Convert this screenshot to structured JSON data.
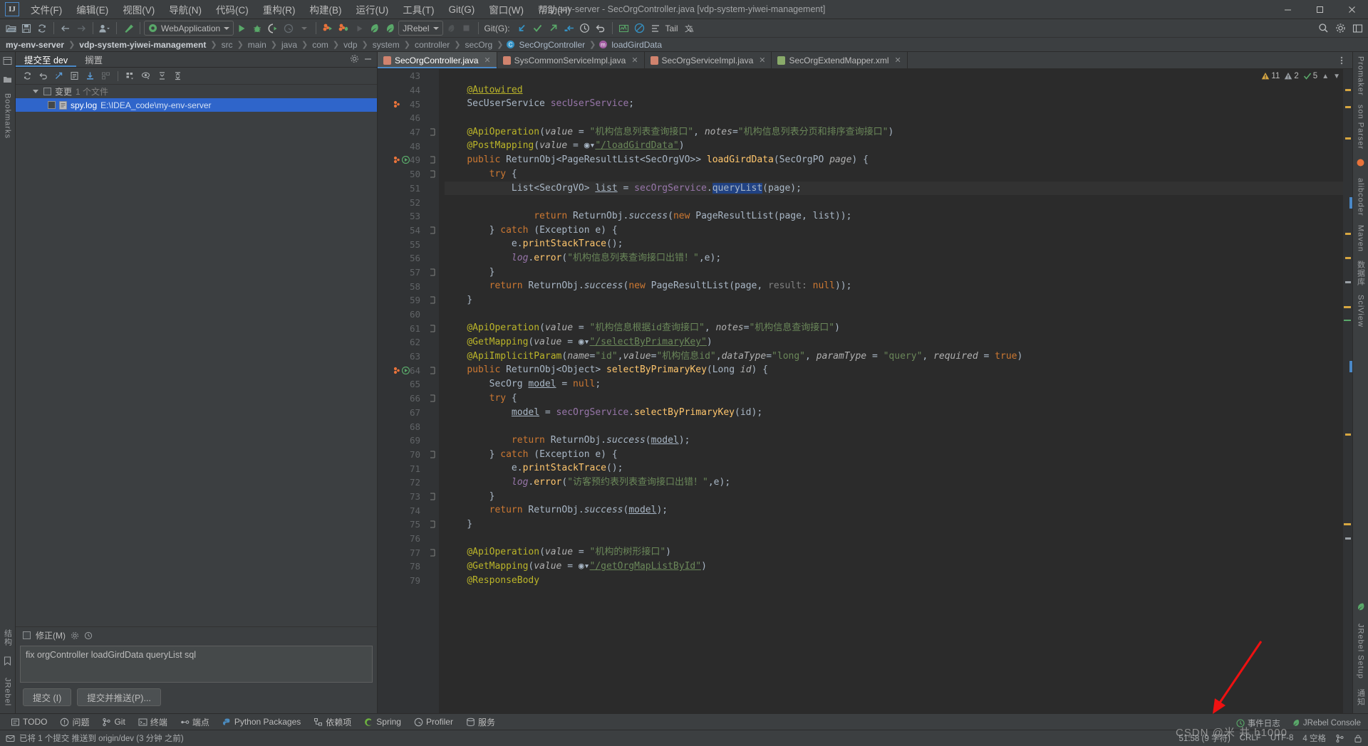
{
  "titlebar": {
    "logo": "IJ",
    "window_title": "my-env-server - SecOrgController.java [vdp-system-yiwei-management]",
    "menus": [
      "文件(F)",
      "编辑(E)",
      "视图(V)",
      "导航(N)",
      "代码(C)",
      "重构(R)",
      "构建(B)",
      "运行(U)",
      "工具(T)",
      "Git(G)",
      "窗口(W)",
      "帮助(H)"
    ],
    "minimize": "—",
    "maximize": "▢",
    "close": "✕"
  },
  "toolbar": {
    "open_icon": "open-folder-icon",
    "save_icon": "save-icon",
    "sync_icon": "sync-icon",
    "back_icon": "back-arrow-icon",
    "forward_icon": "forward-arrow-icon",
    "profile_icon": "user-profile-icon",
    "build_icon": "hammer-icon",
    "run_config": "WebApplication",
    "run_icon": "run-icon",
    "debug_icon": "debug-icon",
    "coverage_icon": "coverage-icon",
    "profiler_icon": "profiler-icon",
    "jrebel_run_icon": "jrebel-run-icon",
    "jrebel_debug_icon": "jrebel-debug-icon",
    "jrebel_config": "JRebel",
    "stop_icon": "stop-icon",
    "git_label": "Git(G):",
    "update_icon": "update-project-icon",
    "commit_icon": "commit-checkmark-icon",
    "push_icon": "push-icon",
    "pull_icon": "pull-icon",
    "history_icon": "history-clock-icon",
    "rollback_icon": "rollback-icon",
    "graph_icon": "chart-icon",
    "noentry_icon": "no-entry-icon",
    "tail_label": "Tail",
    "translate_icon": "translate-icon",
    "search_icon": "search-icon",
    "settings_icon": "settings-gear-icon",
    "layout_icon": "layout-icon"
  },
  "breadcrumb": {
    "items": [
      {
        "label": "my-env-server",
        "style": "bold"
      },
      {
        "label": "vdp-system-yiwei-management",
        "style": "bold"
      },
      {
        "label": "src",
        "style": "plain"
      },
      {
        "label": "main",
        "style": "plain"
      },
      {
        "label": "java",
        "style": "plain"
      },
      {
        "label": "com",
        "style": "plain"
      },
      {
        "label": "vdp",
        "style": "plain"
      },
      {
        "label": "system",
        "style": "plain"
      },
      {
        "label": "controller",
        "style": "plain"
      },
      {
        "label": "secOrg",
        "style": "plain"
      },
      {
        "label": "SecOrgController",
        "style": "class",
        "icon": "class-icon"
      },
      {
        "label": "loadGirdData",
        "style": "method",
        "icon": "method-icon"
      }
    ],
    "separator": "❯"
  },
  "left_rail": {
    "items": [
      "项目",
      "书签",
      "结构"
    ],
    "bottom_items": [
      "Bookmarks",
      "JRebel"
    ]
  },
  "right_rail": {
    "items": [
      "Promaker",
      "son Parser",
      "alibcoder",
      "Maven",
      "数据库",
      "SciView",
      "JRebel Setup",
      "通知"
    ]
  },
  "commit_panel": {
    "tabs": [
      {
        "label": "提交至 dev",
        "active": true
      },
      {
        "label": "搁置",
        "active": false
      }
    ],
    "tab_actions": [
      "settings-gear-icon",
      "minimize-icon"
    ],
    "toolbar_icons": [
      "refresh-icon",
      "rollback-icon",
      "diff-icon",
      "show-diff-icon",
      "download-icon",
      "group-icon",
      "expand-icon",
      "eye-icon",
      "collapse-icon",
      "sort-icon"
    ],
    "changes_node": "变更",
    "changes_count": "1 个文件",
    "files": [
      {
        "name": "spy.log",
        "path": "E:\\IDEA_code\\my-env-server",
        "selected": true,
        "icon": "log-file-icon"
      }
    ],
    "amend_label": "修正(M)",
    "amend_icons": [
      "gear-icon",
      "history-icon"
    ],
    "message": "fix orgController loadGirdData  queryList sql",
    "commit_button": "提交 (I)",
    "commit_push_button": "提交并推送(P)..."
  },
  "editor": {
    "tabs": [
      {
        "label": "SecOrgController.java",
        "icon": "java-file-icon",
        "active": true,
        "closeable": true
      },
      {
        "label": "SysCommonServiceImpl.java",
        "icon": "java-file-icon",
        "active": false,
        "closeable": true
      },
      {
        "label": "SecOrgServiceImpl.java",
        "icon": "java-file-icon",
        "active": false,
        "closeable": true
      },
      {
        "label": "SecOrgExtendMapper.xml",
        "icon": "xml-file-icon",
        "active": false,
        "closeable": true
      }
    ],
    "tabs_overflow_icon": "more-options-icon",
    "inspections": {
      "warnings": "11",
      "weak_warnings": "2",
      "checks": "5",
      "up_icon": "chevron-up-icon",
      "down_icon": "chevron-down-icon",
      "warning_icon": "warning-triangle-icon",
      "weak_icon": "weak-warning-icon",
      "ok_icon": "checkmark-icon"
    },
    "first_line": 43,
    "highlight_line": 51,
    "lines": [
      {
        "n": 43,
        "html": ""
      },
      {
        "n": 44,
        "html": "    <span class=\"anncall\">@Autowired</span>"
      },
      {
        "n": 45,
        "html": "    <span class=\"cls\">SecUserService</span> <span class=\"fld\">secUserService</span>;",
        "gutter": "bean-icon"
      },
      {
        "n": 46,
        "html": ""
      },
      {
        "n": 47,
        "html": "    <span class=\"ann\">@ApiOperation</span>(<span class=\"param\">value</span> = <span class=\"str\">\"机构信息列表查询接口\"</span>, <span class=\"param\">notes</span>=<span class=\"str\">\"机构信息列表分页和排序查询接口\"</span>)",
        "fold": true
      },
      {
        "n": 48,
        "html": "    <span class=\"ann\">@PostMapping</span>(<span class=\"param\">value</span> = <span class=\"web\">◉▾</span><span class=\"str ul\">\"/loadGirdData\"</span>)"
      },
      {
        "n": 49,
        "html": "    <span class=\"kw\">public</span> <span class=\"cls\">ReturnObj</span>&lt;<span class=\"cls\">PageResultList</span>&lt;<span class=\"cls\">SecOrgVO</span>&gt;&gt; <span class=\"fn\">loadGirdData</span>(<span class=\"cls\">SecOrgPO</span> <span class=\"param\">page</span>) {",
        "gutter": "run-bean-icon",
        "fold": true
      },
      {
        "n": 50,
        "html": "        <span class=\"kw\">try</span> {",
        "fold": true
      },
      {
        "n": 51,
        "html": "            <span class=\"cls\">List</span>&lt;<span class=\"cls\">SecOrgVO</span>&gt; <span class=\"ul\">list</span> = <span class=\"fld\">secOrgService</span>.<span class=\"selhl\">queryList</span>(page);",
        "highlight": true
      },
      {
        "n": 52,
        "html": ""
      },
      {
        "n": 53,
        "html": "                <span class=\"kw\">return</span> <span class=\"cls\">ReturnObj</span>.<span class=\"it\">success</span>(<span class=\"kw\">new</span> <span class=\"cls\">PageResultList</span>(page, list));"
      },
      {
        "n": 54,
        "html": "        } <span class=\"kw\">catch</span> (<span class=\"cls\">Exception</span> e) {",
        "fold": true
      },
      {
        "n": 55,
        "html": "            e.<span class=\"fn\">printStackTrace</span>();"
      },
      {
        "n": 56,
        "html": "            <span class=\"it fld\">log</span>.<span class=\"fn\">error</span>(<span class=\"str\">\"机构信息列表查询接口出错！\"</span>,e);"
      },
      {
        "n": 57,
        "html": "        }",
        "fold": true
      },
      {
        "n": 58,
        "html": "        <span class=\"kw\">return</span> <span class=\"cls\">ReturnObj</span>.<span class=\"it\">success</span>(<span class=\"kw\">new</span> <span class=\"cls\">PageResultList</span>(page, <span class=\"cmt\">result:</span> <span class=\"kw\">null</span>));"
      },
      {
        "n": 59,
        "html": "    }",
        "fold": true
      },
      {
        "n": 60,
        "html": ""
      },
      {
        "n": 61,
        "html": "    <span class=\"ann\">@ApiOperation</span>(<span class=\"param\">value</span> = <span class=\"str\">\"机构信息根据id查询接口\"</span>, <span class=\"param\">notes</span>=<span class=\"str\">\"机构信息查询接口\"</span>)",
        "fold": true
      },
      {
        "n": 62,
        "html": "    <span class=\"ann\">@GetMapping</span>(<span class=\"param\">value</span> = <span class=\"web\">◉▾</span><span class=\"str ul\">\"/selectByPrimaryKey\"</span>)"
      },
      {
        "n": 63,
        "html": "    <span class=\"ann\">@ApiImplicitParam</span>(<span class=\"param\">name</span>=<span class=\"str\">\"id\"</span>,<span class=\"param\">value</span>=<span class=\"str\">\"机构信息id\"</span>,<span class=\"param\">dataType</span>=<span class=\"str\">\"long\"</span>, <span class=\"param\">paramType</span> = <span class=\"str\">\"query\"</span>, <span class=\"param\">required</span> = <span class=\"kw\">true</span>)"
      },
      {
        "n": 64,
        "html": "    <span class=\"kw\">public</span> <span class=\"cls\">ReturnObj</span>&lt;<span class=\"cls\">Object</span>&gt; <span class=\"fn\">selectByPrimaryKey</span>(<span class=\"cls\">Long</span> <span class=\"param\">id</span>) {",
        "gutter": "run-bean-icon",
        "fold": true
      },
      {
        "n": 65,
        "html": "        <span class=\"cls\">SecOrg</span> <span class=\"ul\">model</span> = <span class=\"kw\">null</span>;"
      },
      {
        "n": 66,
        "html": "        <span class=\"kw\">try</span> {",
        "fold": true
      },
      {
        "n": 67,
        "html": "            <span class=\"ul\">model</span> = <span class=\"fld\">secOrgService</span>.<span class=\"fn\">selectByPrimaryKey</span>(id);"
      },
      {
        "n": 68,
        "html": ""
      },
      {
        "n": 69,
        "html": "            <span class=\"kw\">return</span> <span class=\"cls\">ReturnObj</span>.<span class=\"it\">success</span>(<span class=\"ul\">model</span>);"
      },
      {
        "n": 70,
        "html": "        } <span class=\"kw\">catch</span> (<span class=\"cls\">Exception</span> e) {",
        "fold": true
      },
      {
        "n": 71,
        "html": "            e.<span class=\"fn\">printStackTrace</span>();"
      },
      {
        "n": 72,
        "html": "            <span class=\"it fld\">log</span>.<span class=\"fn\">error</span>(<span class=\"str\">\"访客预约表列表查询接口出错！\"</span>,e);"
      },
      {
        "n": 73,
        "html": "        }",
        "fold": true
      },
      {
        "n": 74,
        "html": "        <span class=\"kw\">return</span> <span class=\"cls\">ReturnObj</span>.<span class=\"it\">success</span>(<span class=\"ul\">model</span>);"
      },
      {
        "n": 75,
        "html": "    }",
        "fold": true
      },
      {
        "n": 76,
        "html": ""
      },
      {
        "n": 77,
        "html": "    <span class=\"ann\">@ApiOperation</span>(<span class=\"param\">value</span> = <span class=\"str\">\"机构的树形接口\"</span>)",
        "fold": true
      },
      {
        "n": 78,
        "html": "    <span class=\"ann\">@GetMapping</span>(<span class=\"param\">value</span> = <span class=\"web\">◉▾</span><span class=\"str ul\">\"/getOrgMapListById\"</span>)"
      },
      {
        "n": 79,
        "html": "    <span class=\"ann\">@ResponseBody</span>"
      }
    ]
  },
  "bottom_toolwindows": [
    {
      "label": "TODO",
      "icon": "todo-icon"
    },
    {
      "label": "问题",
      "icon": "problems-icon"
    },
    {
      "label": "Git",
      "icon": "git-icon"
    },
    {
      "label": "终端",
      "icon": "terminal-icon"
    },
    {
      "label": "端点",
      "icon": "endpoints-icon"
    },
    {
      "label": "Python Packages",
      "icon": "python-icon"
    },
    {
      "label": "依赖项",
      "icon": "dependencies-icon"
    },
    {
      "label": "Spring",
      "icon": "spring-icon"
    },
    {
      "label": "Profiler",
      "icon": "profiler-icon"
    },
    {
      "label": "服务",
      "icon": "services-icon"
    }
  ],
  "status_bar": {
    "message": "已将 1 个提交 推送到 origin/dev (3 分钟 之前)",
    "caret": "51:58 (9 字符)",
    "line_separator": "CRLF",
    "encoding": "UTF-8",
    "indent": "4 空格",
    "branch_icon": "branch-icon",
    "lock_icon": "lock-icon",
    "event_log": "事件日志",
    "jrebel_console": "JRebel Console",
    "jrebel_icon": "jrebel-icon"
  },
  "watermark": "CSDN @米 井 h1000",
  "colors": {
    "accent": "#4a88c7",
    "selection": "#2f65ca",
    "editor_bg": "#2b2b2b",
    "panel_bg": "#3c3f41",
    "gutter_bg": "#313335",
    "string": "#6a8759",
    "keyword": "#cc7832",
    "annotation": "#bbb529",
    "method": "#ffc66d",
    "field": "#9876aa",
    "number": "#6897bb",
    "arrow_annotation": "#ee1111"
  }
}
